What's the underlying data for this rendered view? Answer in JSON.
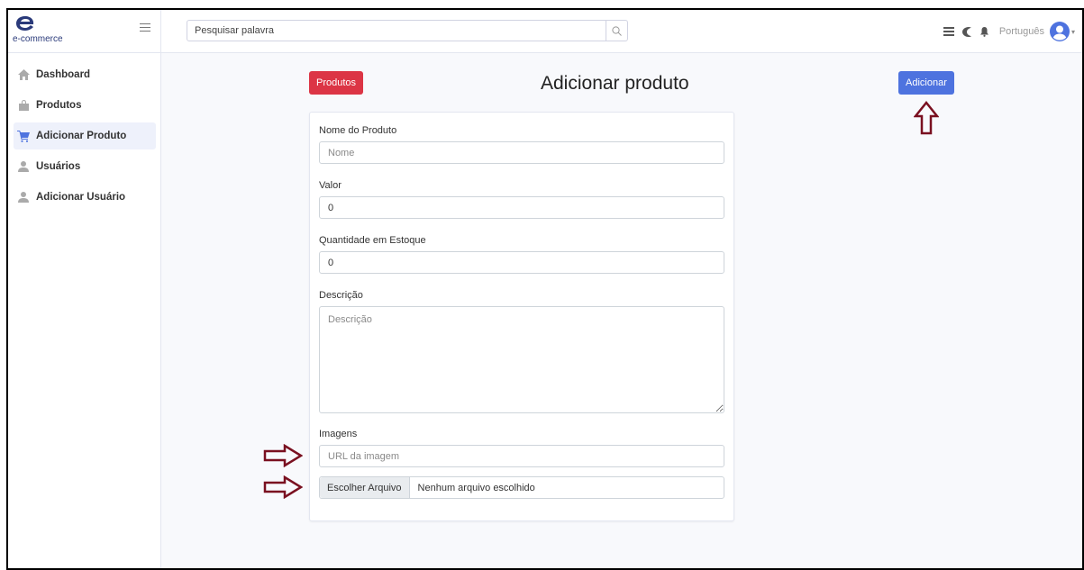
{
  "brand": {
    "name": "e-commerce",
    "logo_icon": "e-logo-icon",
    "menu_icon": "hamburger-icon"
  },
  "sidebar": {
    "items": [
      {
        "label": "Dashboard",
        "icon": "home-icon",
        "active": false
      },
      {
        "label": "Produtos",
        "icon": "bag-icon",
        "active": false
      },
      {
        "label": "Adicionar Produto",
        "icon": "cart-icon",
        "active": true
      },
      {
        "label": "Usuários",
        "icon": "user-icon",
        "active": false
      },
      {
        "label": "Adicionar Usuário",
        "icon": "user-icon",
        "active": false
      }
    ]
  },
  "topbar": {
    "search_placeholder": "Pesquisar palavra",
    "search_icon": "search-icon",
    "icons": [
      "list-icon",
      "moon-icon",
      "bell-icon"
    ],
    "language": "Português",
    "avatar_icon": "user-avatar-icon"
  },
  "header": {
    "products_button": "Produtos",
    "title": "Adicionar produto",
    "add_button": "Adicionar"
  },
  "form": {
    "name_label": "Nome do Produto",
    "name_placeholder": "Nome",
    "value_label": "Valor",
    "value_value": "0",
    "stock_label": "Quantidade em Estoque",
    "stock_value": "0",
    "description_label": "Descrição",
    "description_placeholder": "Descrição",
    "images_label": "Imagens",
    "image_url_placeholder": "URL da imagem",
    "file_button": "Escolher Arquivo",
    "file_status": "Nenhum arquivo escolhido"
  },
  "colors": {
    "red_button": "#dc3545",
    "blue_button": "#4e73df",
    "annotation_arrow": "#7a1020"
  }
}
